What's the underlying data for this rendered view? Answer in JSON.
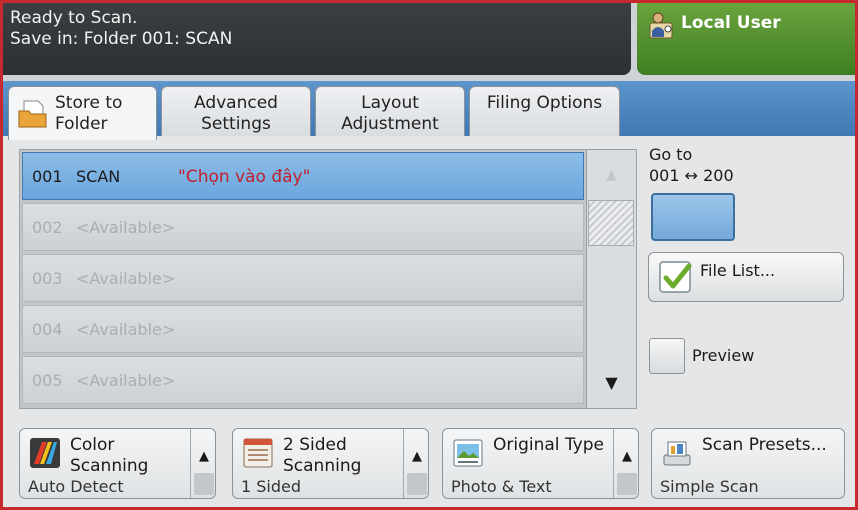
{
  "status": {
    "line1": "Ready to Scan.",
    "line2": "Save in: Folder 001: SCAN"
  },
  "user": {
    "label": "Local User"
  },
  "tabs": [
    {
      "line1": "Store to",
      "line2": "Folder"
    },
    {
      "line1": "Advanced",
      "line2": "Settings"
    },
    {
      "line1": "Layout",
      "line2": "Adjustment"
    },
    {
      "line1": "Filing Options",
      "line2": ""
    }
  ],
  "folders": [
    {
      "num": "001",
      "name": "SCAN",
      "note": "\"Chọn vào đây\""
    },
    {
      "num": "002",
      "name": "<Available>"
    },
    {
      "num": "003",
      "name": "<Available>"
    },
    {
      "num": "004",
      "name": "<Available>"
    },
    {
      "num": "005",
      "name": "<Available>"
    }
  ],
  "scrollbar": {
    "up": "▲",
    "down": "▼"
  },
  "goto": {
    "label": "Go to",
    "range": "001 ↔ 200"
  },
  "file_list": {
    "label": "File List..."
  },
  "preview": {
    "label": "Preview"
  },
  "features": [
    {
      "line1": "Color",
      "line2": "Scanning",
      "value": "Auto Detect",
      "up": "▲"
    },
    {
      "line1": "2 Sided",
      "line2": "Scanning",
      "value": "1 Sided",
      "up": "▲"
    },
    {
      "line1": "Original Type",
      "line2": "",
      "value": "Photo & Text",
      "up": "▲"
    },
    {
      "line1": "Scan Presets...",
      "line2": "",
      "value": "Simple Scan"
    }
  ],
  "colors": {
    "accent_blue": "#4a84c0",
    "user_green": "#55922f",
    "note_red": "#c0202a"
  }
}
